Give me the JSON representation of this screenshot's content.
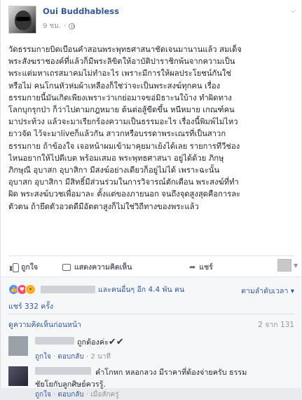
{
  "post": {
    "author": "Oui Buddhabless",
    "time": "9 ชม.",
    "time_separator": "·",
    "lines": [
      "วัดธรรมกายบิดเบือนคำสอนพระพุทธศาสนาชัดเจนมานานแล้ว สมเด็จ",
      "พระสังฆราชองค์ที่แล้วก็มีพระลิขิตให้อาบัติปาราชิกพ้นจากความเป็น",
      "พระแต่มหาเถรสมาคมไม่ทำอะไร เพราะมีการให้ผลประโยชน์กันใช่",
      "หรือไม่ คนโกนหัวห่มผ้าเหลืองก็ใช่ว่าจะเป็นพระสงฆ์ทุกคน เรื่อง",
      "ธรรมกายนี้มันเกิดเพียงเพราะว่าเกย่อมาจขอ่มิธาะนใบ้าง ทำผิดทาง",
      "โลกบุกรุกป่า ก็ว่าไปตามกฎหมาย ต้นต่อสู้ขีดขึ้น หนีหมาย เกณฑ์คน",
      "มาประท้วง แล้วจะมาเรียกร้องความเป็นธรรมอะไร เรื่องนี้พิมพ์ไม่ไหว",
      "ยาวจัด ไว้จะมาliveก็แล้วกัน สาวกหรือบรรดาพระเณรที่เป็นสาวก",
      "ธรรมกาย ถ้าข้องใจ เจอหน้าผมเข้ามาคุยมาเย้งได้เลย รายการทีวีช่อง",
      "ไหนอยากให้ไปดีเบต พร้อมเสมอ พระพุทธศาสนา อยู่ได้ด้วย ภิกษุ",
      "ภิกษุณี อุบาสก อุบาสิกา มีสงฆ์อย่างเดียวก็อยู่ไม่ได้ เพราะฉะนั้น",
      "อุบาสก อุบาสิกา มีสิทธิ์มีส่วนร่วมในการวิจารณ์ตักเตือน พระสงฆ์ที่ทำ",
      "ผิด พระสงฆ์บวชเพื่อมาละ ตั้งแต่ของภายนอก จนถึงจุดสูงสุดคือการละ",
      "ตัวตน ถ้ายึดตัวอวดดีมีอัตตาสูงก็ไม่ใช่วิถีทางของพระแล้ว"
    ]
  },
  "actions": {
    "like": "ถูกใจ",
    "comment": "แสดงความคิดเห็น",
    "share": "แชร์"
  },
  "feedback": {
    "reactions_text": "และคนอื่นๆ อีก 4.4 พัน คน",
    "sort_label": "ตามลำดับเวลา",
    "shares": "แชร์ 332 ครั้ง",
    "previous_comments": "ดูความคิดเห็นก่อนหน้า",
    "comment_count": "2 จาก 131"
  },
  "comments": [
    {
      "text": "ถูกต้องค่ะ",
      "checks": "✔✔",
      "like": "ถูกใจ",
      "reply": "ตอบกลับ",
      "time": "2 นาที"
    },
    {
      "text_line1": "คำโกหก หลอกลวง มีราคาที่ต้องจ่ายครับ ธรรม",
      "text_line2": "ชัยโยกับลูกศิษย์ควรรู้.",
      "like": "ถูกใจ",
      "reply": "ตอบกลับ",
      "time": "เมื่อสักครู่"
    }
  ],
  "icons": {
    "like": "thumbs-up-icon",
    "comment": "speech-bubble-icon",
    "share": "share-arrow-icon",
    "privacy": "globe-icon",
    "options": "chevron-down-icon"
  },
  "colors": {
    "link": "#365899",
    "meta": "#90949c",
    "like_reaction": "#5890ff",
    "love_reaction": "#f25268",
    "wow_reaction": "#f7b125"
  }
}
